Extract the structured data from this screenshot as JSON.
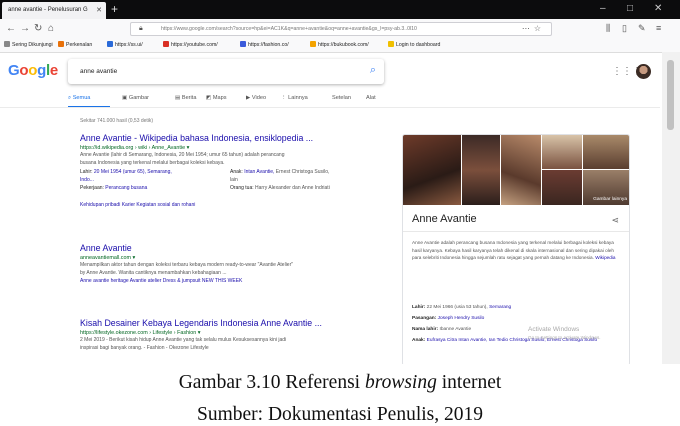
{
  "browser": {
    "tab_title": "anne avantie - Penelusuran G",
    "url": "https://www.google.com/search?source=hp&ei=AC1K&q=anne+avantie&oq=anne+avantie&gs_l=psy-ab.3..0l10",
    "bookmarks": [
      "Sering Dikunjungi",
      "Perkenalan",
      "https://ss.ui/",
      "https://youtube.com/",
      "https://fashion.co/",
      "https://bukubook.com/",
      "Login to dashboard"
    ]
  },
  "google": {
    "logo_letters": [
      "G",
      "o",
      "o",
      "g",
      "l",
      "e"
    ],
    "logo_colors": [
      "#4285f4",
      "#ea4335",
      "#fbbc05",
      "#4285f4",
      "#34a853",
      "#ea4335"
    ],
    "query": "anne avantie",
    "tabs": [
      "Semua",
      "Gambar",
      "Berita",
      "Maps",
      "Video",
      "Lainnya",
      "Setelan",
      "Alat"
    ],
    "stats": "Sekitar 741.000 hasil (0,53 detik)"
  },
  "results": [
    {
      "title": "Anne Avantie - Wikipedia bahasa Indonesia, ensiklopedia ...",
      "url": "https://id.wikipedia.org › wiki › Anne_Avantie ▾",
      "snippet": [
        "Anne Avantie (lahir di Semarang, Indonesia, 20 Mei 1954; umur 65 tahun) adalah perancang",
        "busana Indonesia yang terkenal melalui berbagai koleksi kebaya."
      ],
      "facts": {
        "lahir_label": "Lahir:",
        "lahir_value": "20 Mei 1954 (umur 65),",
        "lahir_place": "Semarang,",
        "lahir_place2": "Indo...",
        "anak_label": "Anak:",
        "anak_value": "Intan Avantie,",
        "anak_more": "Ernest Christoga Susilo,",
        "anak_more2": "lain",
        "kerja_label": "Pekerjaan:",
        "kerja_value": "Perancang busana",
        "ortu_label": "Orang tua:",
        "ortu_value": "Harry Alexander dan Anne Indriati"
      },
      "links": "Kehidupan pribadi   Karier   Kegiatan sosial dan rohani"
    },
    {
      "title": "Anne Avantie",
      "url": "anneavantiemall.com ▾",
      "snippet": [
        "Menampilkan aktor tahun dengan koleksi terbaru kebaya modern ready-to-wear \"Avantie Atelier\"",
        "by Anne Avantie. Wanita cantiknya menambahkan kebahagiaan ..."
      ],
      "links": "Anne avantie heritage   Avantie atelier   Dress & jumpsuit   NEW THIS WEEK"
    },
    {
      "title": "Kisah Desainer Kebaya Legendaris Indonesia Anne Avantie ...",
      "url": "https://lifestyle.okezone.com › Lifestyle › Fashion ▾",
      "snippet": [
        "2 Mei 2019 - Berikut kisah hidup Anne Avantie yang tak selalu mulus Kesuksesannya kini jadi",
        "inspirasi bagi banyak orang. - Fashion - Okezone Lifestyle"
      ]
    }
  ],
  "knowledge_panel": {
    "more_images": "Gambar lainnya",
    "title": "Anne Avantie",
    "description": "Anne Avantie adalah perancang busana Indonesia yang terkenal melalui berbagai koleksi kebaya hasil karyanya. Kebaya hasil karyanya telah dikenal di skala internasional dan sering dipakai oleh para selebriti Indonesia hingga sejumlah ratu sejagat yang pernah datang ke Indonesia.",
    "wiki_link": "Wikipedia",
    "facts": [
      {
        "label": "Lahir:",
        "value": "22 Mei 1966 (usia 53 tahun),",
        "link": "Semarang"
      },
      {
        "label": "Pasangan:",
        "value": "",
        "link": "Joseph Hendry Susilo"
      },
      {
        "label": "Nama lahir:",
        "value": "Ibanne Avantie",
        "link": ""
      },
      {
        "label": "Anak:",
        "value": "",
        "link": "Eufrasya Citra Intan Avantie, Ian Tedio Christoga Susilo, Ernest Christoga Susilo"
      }
    ]
  },
  "watermark": {
    "line1": "Activate Windows",
    "line2": "Go to Settings to activate Windows."
  },
  "caption": {
    "line1_pre": "Gambar 3.10 Referensi ",
    "line1_em": "browsing",
    "line1_post": " internet",
    "line2": "Sumber: Dokumentasi Penulis, 2019"
  }
}
